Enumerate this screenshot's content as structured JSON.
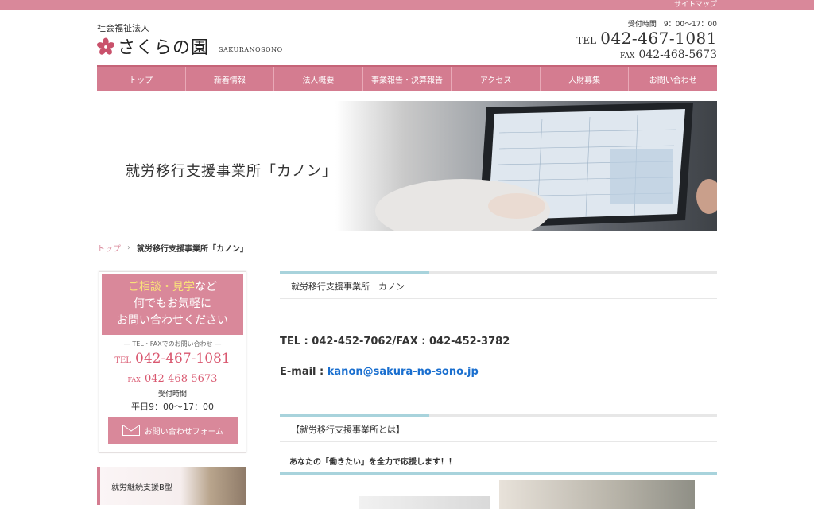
{
  "topbar": {
    "sitemap": "サイトマップ"
  },
  "header": {
    "corp_type": "社会福祉法人",
    "org_name": "さくらの園",
    "org_roman": "SAKURANOSONO",
    "hours": "受付時間　9：00〜17：00",
    "tel_label": "TEL",
    "tel": "042-467-1081",
    "fax_label": "FAX",
    "fax": "042-468-5673"
  },
  "nav": {
    "items": [
      "トップ",
      "新着情報",
      "法人概要",
      "事業報告・決算報告",
      "アクセス",
      "人財募集",
      "お問い合わせ"
    ]
  },
  "hero": {
    "title": "就労移行支援事業所「カノン」"
  },
  "breadcrumb": {
    "home": "トップ",
    "sep": "›",
    "current": "就労移行支援事業所「カノン」"
  },
  "sidebar": {
    "contact": {
      "hl1": "ご相談・見学",
      "line1_rest": "など",
      "line2": "何でもお気軽に",
      "line3": "お問い合わせください",
      "sub": "― TEL・FAXでのお問い合わせ ―",
      "tel_label": "TEL",
      "tel": "042-467-1081",
      "fax_label": "FAX",
      "fax": "042-468-5673",
      "hours_label": "受付時間",
      "hours": "平日9：00〜17：00",
      "form_button": "お問い合わせフォーム"
    },
    "banner": "就労継続支援B型"
  },
  "main": {
    "heading1": "就労移行支援事業所　カノン",
    "tel_line": "TEL : 042-452-7062/FAX : 042-452-3782",
    "email_label": "E-mail : ",
    "email": "kanon@sakura-no-sono.jp",
    "heading2": "【就労移行支援事業所とは】",
    "catch": "あなたの「働きたい」を全力で応援します！！"
  },
  "colors": {
    "accent_pink": "#d9889a",
    "nav_pink": "#d47c90",
    "accent_blue": "#a8d3dc",
    "link_blue": "#1a6fcf"
  }
}
